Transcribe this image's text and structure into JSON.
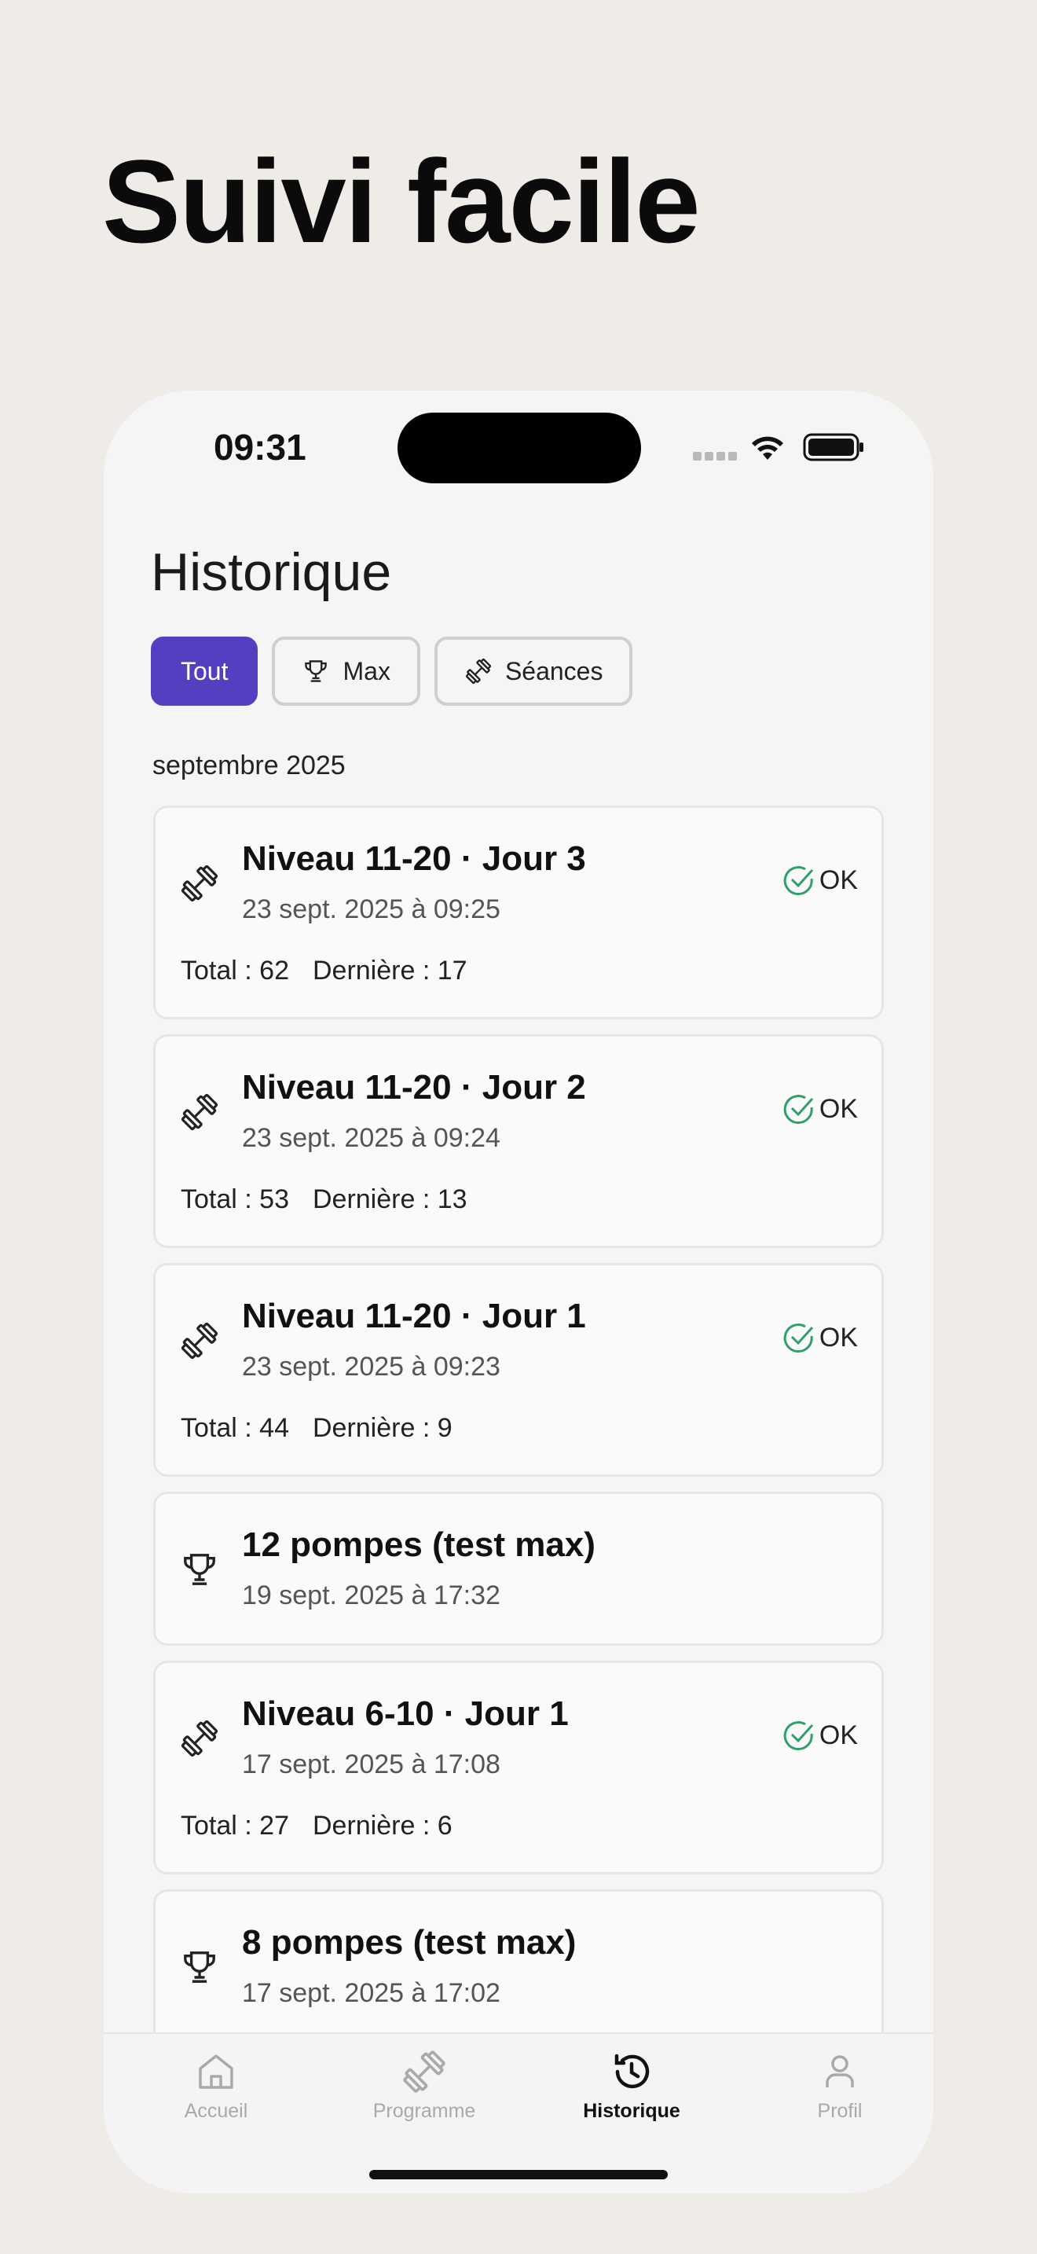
{
  "hero": {
    "title": "Suivi facile"
  },
  "status_bar": {
    "time": "09:31"
  },
  "header": {
    "title": "Historique"
  },
  "filters": [
    {
      "label": "Tout",
      "icon": "none",
      "active": true
    },
    {
      "label": "Max",
      "icon": "trophy-icon",
      "active": false
    },
    {
      "label": "Séances",
      "icon": "dumbbell-icon",
      "active": false
    }
  ],
  "month_label": "septembre 2025",
  "entries": [
    {
      "type": "session",
      "icon": "dumbbell-icon",
      "title": "Niveau 11-20 · Jour 3",
      "date": "23 sept. 2025 à 09:25",
      "status": "OK",
      "total": "Total : 62",
      "last": "Dernière : 17"
    },
    {
      "type": "session",
      "icon": "dumbbell-icon",
      "title": "Niveau 11-20 · Jour 2",
      "date": "23 sept. 2025 à 09:24",
      "status": "OK",
      "total": "Total : 53",
      "last": "Dernière : 13"
    },
    {
      "type": "session",
      "icon": "dumbbell-icon",
      "title": "Niveau 11-20 · Jour 1",
      "date": "23 sept. 2025 à 09:23",
      "status": "OK",
      "total": "Total : 44",
      "last": "Dernière : 9"
    },
    {
      "type": "max",
      "icon": "trophy-icon",
      "title": "12 pompes (test max)",
      "date": "19 sept. 2025 à 17:32"
    },
    {
      "type": "session",
      "icon": "dumbbell-icon",
      "title": "Niveau 6-10 · Jour 1",
      "date": "17 sept. 2025 à 17:08",
      "status": "OK",
      "total": "Total : 27",
      "last": "Dernière : 6"
    },
    {
      "type": "max",
      "icon": "trophy-icon",
      "title": "8 pompes (test max)",
      "date": "17 sept. 2025 à 17:02"
    }
  ],
  "tabs": [
    {
      "label": "Accueil",
      "icon": "home-icon",
      "active": false
    },
    {
      "label": "Programme",
      "icon": "dumbbell-icon",
      "active": false
    },
    {
      "label": "Historique",
      "icon": "history-icon",
      "active": true
    },
    {
      "label": "Profil",
      "icon": "person-icon",
      "active": false
    }
  ],
  "colors": {
    "accent": "#5240c0",
    "ok": "#2f9e6b",
    "background": "#efebe7"
  }
}
